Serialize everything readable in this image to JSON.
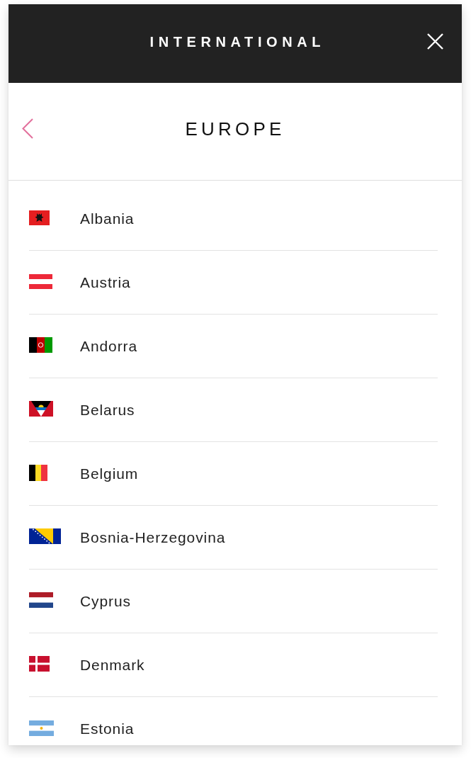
{
  "header": {
    "title": "INTERNATIONAL"
  },
  "subheader": {
    "title": "EUROPE"
  },
  "countries": [
    {
      "name": "Albania",
      "kind": "albania"
    },
    {
      "name": "Austria",
      "kind": "austria"
    },
    {
      "name": "Andorra",
      "kind": "afghanistan"
    },
    {
      "name": "Belarus",
      "kind": "antigua"
    },
    {
      "name": "Belgium",
      "kind": "belgium"
    },
    {
      "name": "Bosnia-Herzegovina",
      "kind": "bosnia"
    },
    {
      "name": "Cyprus",
      "kind": "netherlands"
    },
    {
      "name": "Denmark",
      "kind": "denmark"
    },
    {
      "name": "Estonia",
      "kind": "argentina"
    }
  ]
}
